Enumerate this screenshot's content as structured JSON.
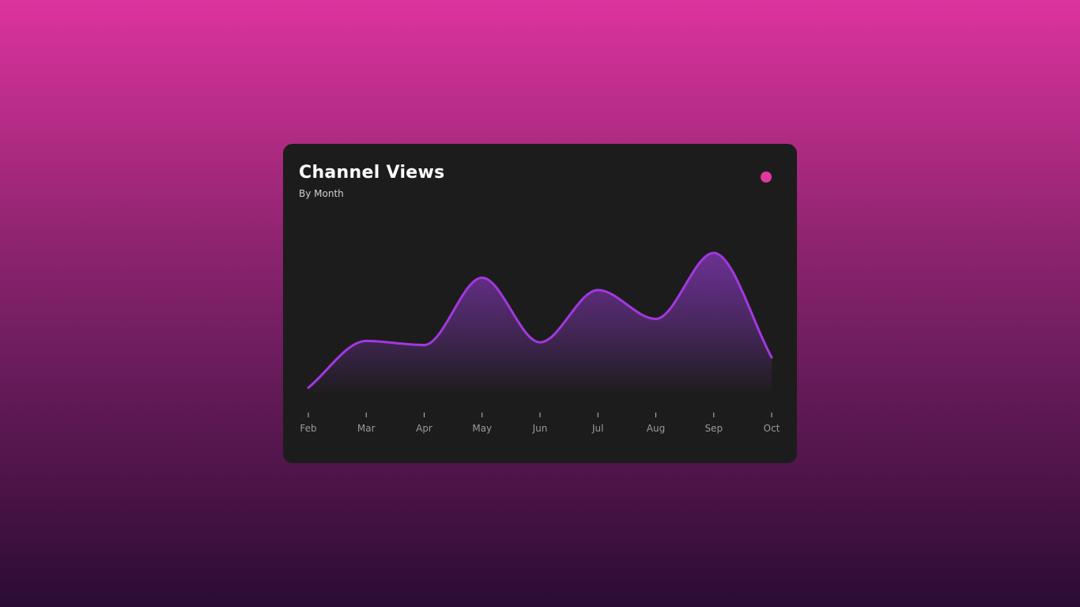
{
  "card": {
    "title": "Channel Views",
    "subtitle": "By Month"
  },
  "colors": {
    "line": "#a238e0",
    "fill_top": "#7a34a8",
    "fill_bottom": "#1c1c1c",
    "legend_dot": "#e0399e",
    "tick": "#bdbdbd"
  },
  "chart_data": {
    "type": "area",
    "title": "Channel Views",
    "subtitle": "By Month",
    "categories": [
      "Feb",
      "Mar",
      "Apr",
      "May",
      "Jun",
      "Jul",
      "Aug",
      "Sep",
      "Oct"
    ],
    "series": [
      {
        "values": [
          2,
          36,
          33,
          82,
          35,
          73,
          52,
          100,
          24
        ]
      }
    ],
    "ylim": [
      0,
      100
    ],
    "grid": false,
    "legend": "top-right",
    "curve": "smooth"
  }
}
